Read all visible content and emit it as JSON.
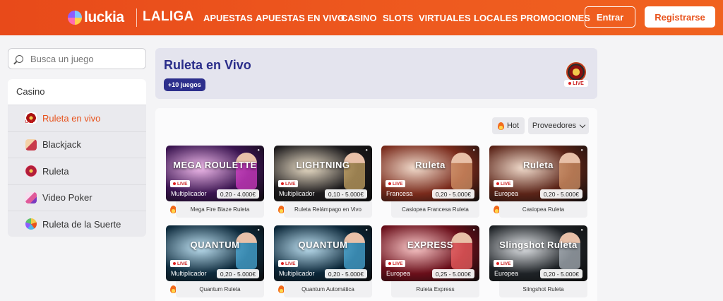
{
  "header": {
    "logo_text": "luckia",
    "partner": "LALIGA",
    "nav": [
      "APUESTAS",
      "APUESTAS EN VIVO",
      "CASINO",
      "SLOTS",
      "VIRTUALES",
      "LOCALES",
      "PROMOCIONES"
    ],
    "login_label": "Entrar",
    "register_label": "Registrarse"
  },
  "sidebar": {
    "search_placeholder": "Busca un juego",
    "section_title": "Casino",
    "items": [
      {
        "label": "Ruleta en vivo",
        "icon": "roulette-live-icon",
        "active": true
      },
      {
        "label": "Blackjack",
        "icon": "blackjack-icon",
        "active": false
      },
      {
        "label": "Ruleta",
        "icon": "roulette-icon",
        "active": false
      },
      {
        "label": "Video Poker",
        "icon": "video-poker-icon",
        "active": false
      },
      {
        "label": "Ruleta de la Suerte",
        "icon": "wheel-of-fortune-icon",
        "active": false
      }
    ],
    "icon_live_badge": "LIVE"
  },
  "main": {
    "title": "Ruleta en Vivo",
    "count_badge": "+10 juegos",
    "live_label": "LIVE",
    "hot_label": "Hot",
    "providers_label": "Proveedores"
  },
  "games": [
    {
      "art": "MEGA ROULETTE",
      "name": "Mega Fire Blaze Ruleta",
      "type": "Multiplicador",
      "range": "0,20 - 4.000€",
      "hot": true,
      "bg": "#3a1450",
      "accent": "#e23fd0"
    },
    {
      "art": "LIGHTNING",
      "name": "Ruleta Relámpago en Vivo",
      "type": "Multiplicador",
      "range": "0,10 - 5.000€",
      "hot": true,
      "bg": "#1c1a1c",
      "accent": "#d8b26a"
    },
    {
      "art": "Ruleta",
      "name": "Casiopea Francesa Ruleta",
      "type": "Francesa",
      "range": "0,20 - 5.000€",
      "hot": false,
      "bg": "#7a2b1c",
      "accent": "#e0a070"
    },
    {
      "art": "Ruleta",
      "name": "Casiopea Ruleta",
      "type": "Europea",
      "range": "0,20 - 5.000€",
      "hot": true,
      "bg": "#5b2418",
      "accent": "#e0a070"
    },
    {
      "art": "QUANTUM",
      "name": "Quantum Ruleta",
      "type": "Multiplicador",
      "range": "0,20 - 5.000€",
      "hot": true,
      "bg": "#0d2a3c",
      "accent": "#4fb7e8"
    },
    {
      "art": "QUANTUM",
      "name": "Quantum Automática",
      "type": "Multiplicador",
      "range": "0,20 - 5.000€",
      "hot": true,
      "bg": "#0a2638",
      "accent": "#4fb7e8"
    },
    {
      "art": "EXPRESS",
      "name": "Ruleta Express",
      "type": "Europea",
      "range": "0,25 - 5.000€",
      "hot": false,
      "bg": "#6a0f1a",
      "accent": "#ff6a6a"
    },
    {
      "art": "Slingshot Ruleta",
      "name": "Slingshot Ruleta",
      "type": "Europea",
      "range": "0,20 - 5.000€",
      "hot": false,
      "bg": "#1e2226",
      "accent": "#b8c0c8"
    }
  ],
  "game_live_label": "LIVE",
  "colors": {
    "brand": "#e8521c",
    "banner_title": "#2a2d8a",
    "badge": "#2d2f8c"
  }
}
